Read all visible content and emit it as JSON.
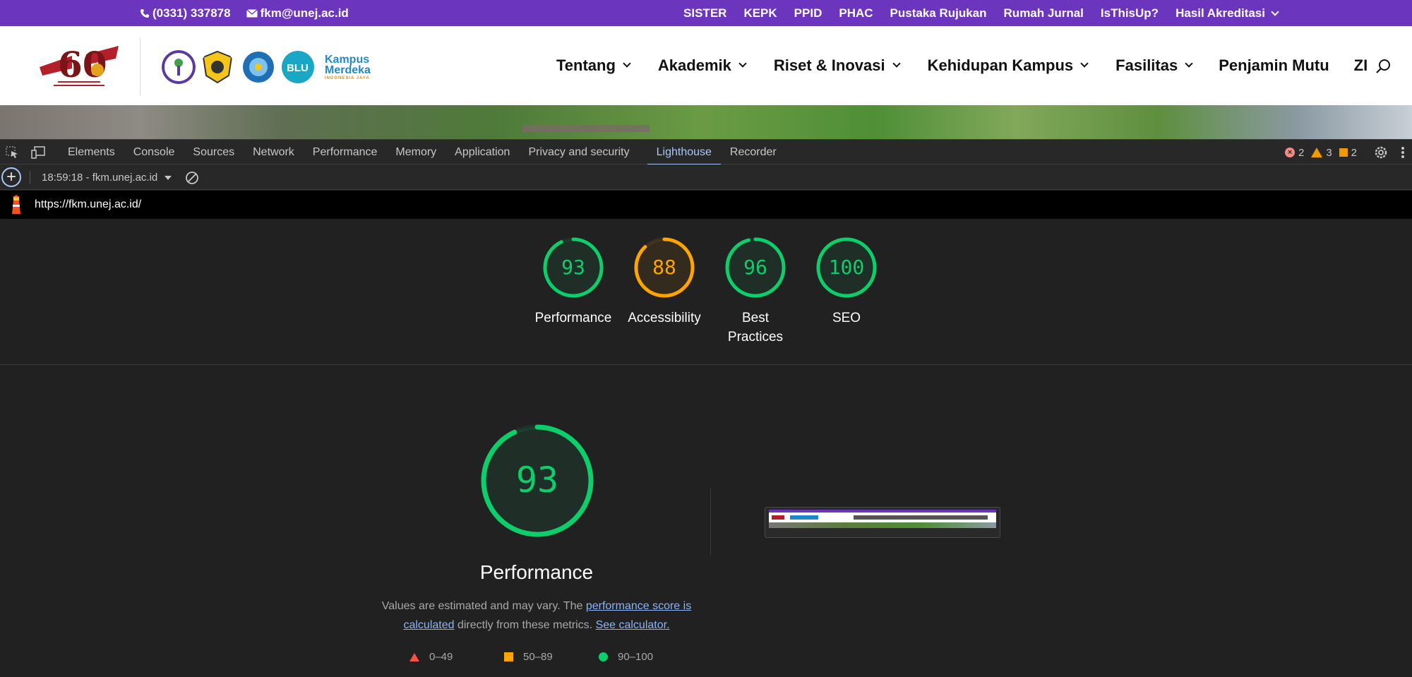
{
  "site": {
    "topbar": {
      "phone": "(0331) 337878",
      "email": "fkm@unej.ac.id",
      "links": [
        "SISTER",
        "KEPK",
        "PPID",
        "PHAC",
        "Pustaka Rujukan",
        "Rumah Jurnal",
        "IsThisUp?",
        "Hasil Akreditasi"
      ]
    },
    "nav": [
      "Tentang",
      "Akademik",
      "Riset & Inovasi",
      "Kehidupan Kampus",
      "Fasilitas",
      "Penjamin Mutu",
      "ZI"
    ],
    "logo_text": "60",
    "merdeka_logo": {
      "line1": "Kampus",
      "line2": "Merdeka",
      "tag": "INDONESIA JAYA"
    },
    "colors": {
      "topbar": "#6c35bd",
      "logo_red": "#b3202a"
    }
  },
  "devtools": {
    "tabs": [
      "Elements",
      "Console",
      "Sources",
      "Network",
      "Performance",
      "Memory",
      "Application",
      "Privacy and security",
      "Lighthouse",
      "Recorder"
    ],
    "active_tab": "Lighthouse",
    "errors": "2",
    "warnings": "3",
    "issues": "2",
    "report_select": "18:59:18 - fkm.unej.ac.id",
    "url": "https://fkm.unej.ac.id/"
  },
  "lighthouse": {
    "categories": [
      {
        "label": "Performance",
        "score": 93,
        "color": "#0cce6b"
      },
      {
        "label": "Accessibility",
        "score": 88,
        "color": "#ffa400"
      },
      {
        "label": "Best Practices",
        "score": 96,
        "color": "#0cce6b"
      },
      {
        "label": "SEO",
        "score": 100,
        "color": "#0cce6b"
      }
    ],
    "performance": {
      "score": 93,
      "title": "Performance",
      "desc_prefix": "Values are estimated and may vary. The ",
      "link1": "performance score is calculated",
      "desc_middle": " directly from these metrics. ",
      "link2": "See calculator."
    },
    "legend": [
      {
        "range": "0–49",
        "shape": "triangle",
        "color": "#ff4e42"
      },
      {
        "range": "50–89",
        "shape": "square",
        "color": "#ffa400"
      },
      {
        "range": "90–100",
        "shape": "circle",
        "color": "#0cce6b"
      }
    ]
  }
}
